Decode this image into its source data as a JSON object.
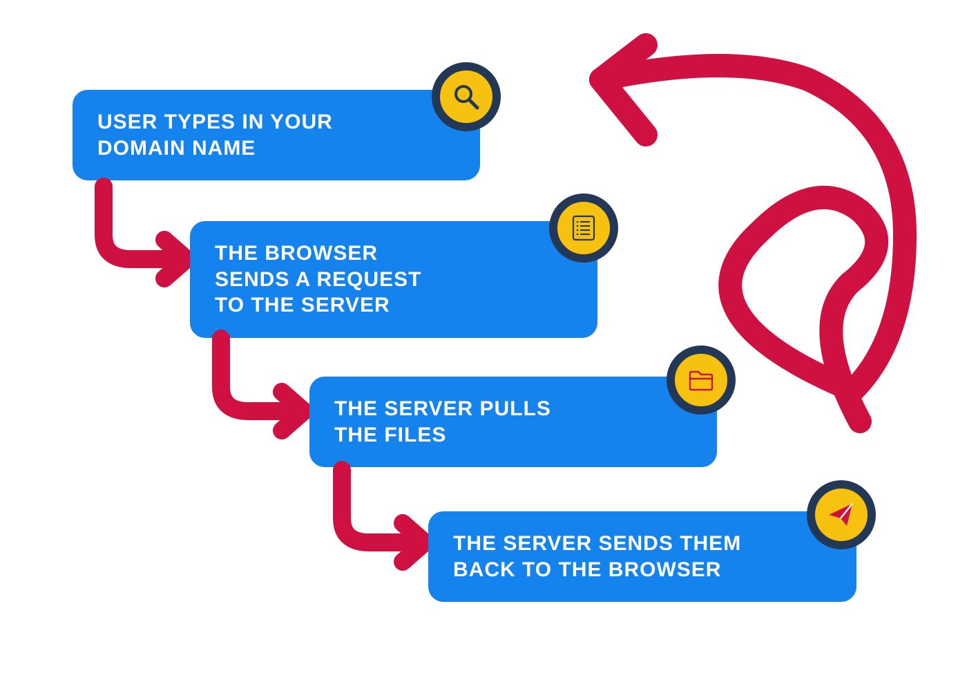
{
  "colors": {
    "card_bg": "#1583EE",
    "accent_red": "#CE1141",
    "badge_fill": "#F7C20F",
    "badge_ring": "#233757"
  },
  "steps": [
    {
      "label": "USER TYPES IN YOUR\nDOMAIN NAME",
      "icon": "search-icon"
    },
    {
      "label": "THE BROWSER\nSENDS A REQUEST\nTO THE SERVER",
      "icon": "list-icon"
    },
    {
      "label": "THE SERVER PULLS\nTHE FILES",
      "icon": "folder-icon"
    },
    {
      "label": "THE SERVER SENDS THEM\nBACK TO THE BROWSER",
      "icon": "send-icon"
    }
  ]
}
